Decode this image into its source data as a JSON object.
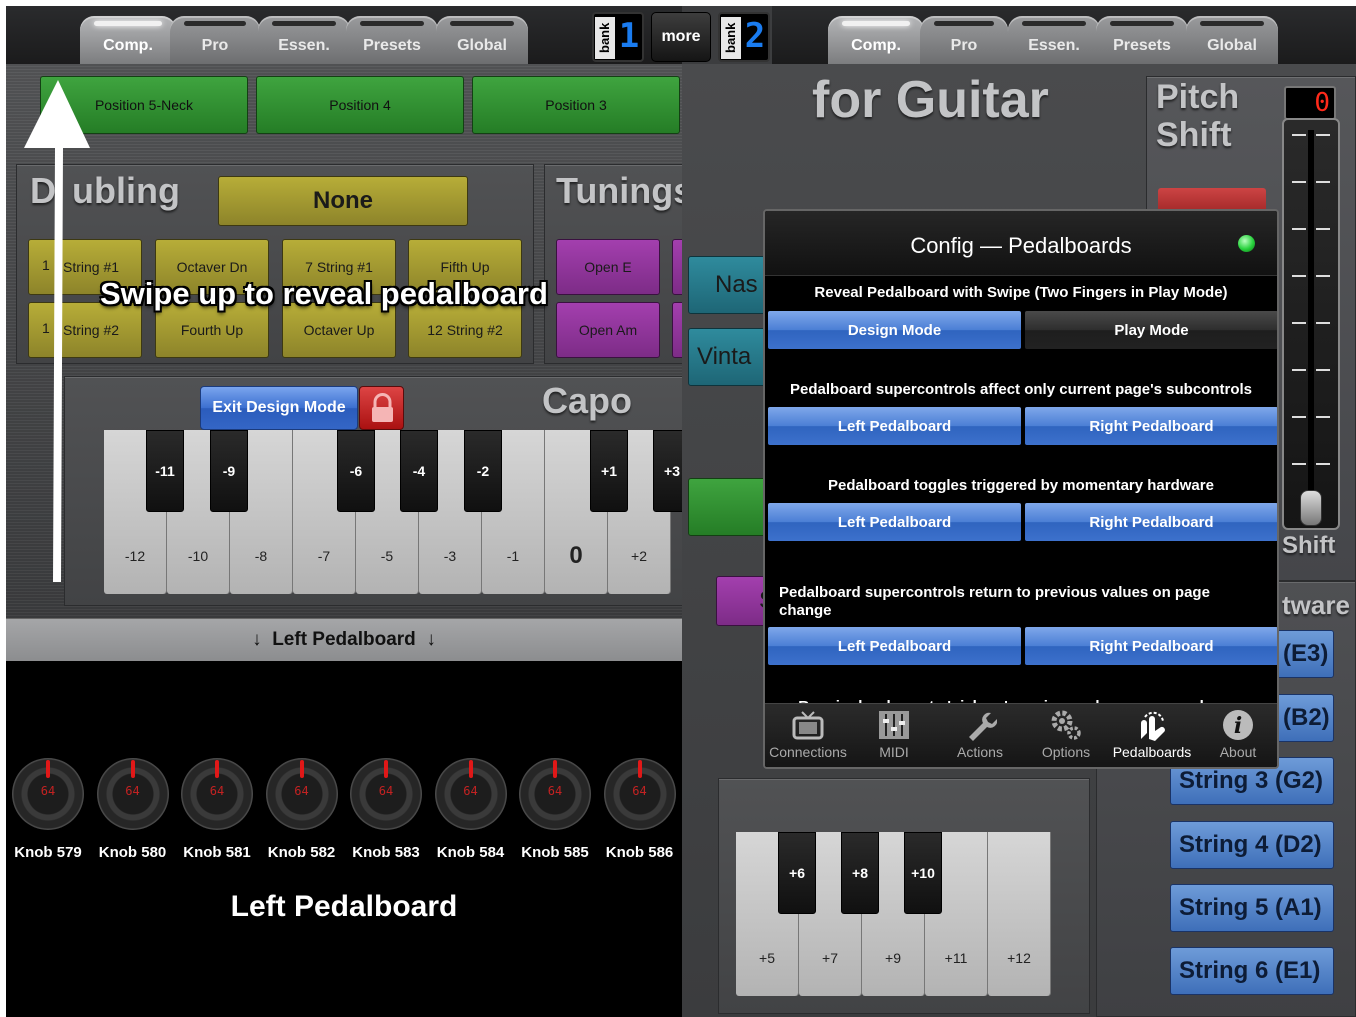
{
  "left_panel": {
    "tabs": [
      "Comp.",
      "Pro",
      "Essen.",
      "Presets",
      "Global"
    ],
    "positions": [
      "Position 5-Neck",
      "Position 4",
      "Position 3"
    ],
    "doubling": {
      "title": "Doubling",
      "title_visible": "D",
      "title_visible_2": "ubling",
      "selected": "None",
      "buttons": [
        "12 String #1",
        "Octaver Dn",
        "7 String #1",
        "Fifth Up",
        "12 String #2",
        "Fourth Up",
        "Octaver Up",
        "12 String #2"
      ],
      "buttons_visible": [
        "1",
        "String #1",
        "Octaver Dn",
        "7 String #1",
        "Fifth Up",
        "1",
        "String #2",
        "Fourth Up",
        "Octaver Up",
        "12 String #2"
      ]
    },
    "tunings": {
      "title": "Tunings",
      "buttons": [
        "Open E",
        "Open Am"
      ]
    },
    "capo": {
      "title": "Capo",
      "exit_design_mode": "Exit Design Mode",
      "white_keys": [
        "-12",
        "-10",
        "-8",
        "-7",
        "-5",
        "-3",
        "-1",
        "0",
        "+2"
      ],
      "black_keys": [
        "-11",
        "-9",
        "-6",
        "-4",
        "-2",
        "+1",
        "+3"
      ]
    },
    "swipe_hint": "Swipe up to reveal pedalboard",
    "pedal_header": "↓  Left Pedalboard  ↓",
    "knobs": [
      {
        "label": "Knob 579",
        "value": "64"
      },
      {
        "label": "Knob 580",
        "value": "64"
      },
      {
        "label": "Knob 581",
        "value": "64"
      },
      {
        "label": "Knob 582",
        "value": "64"
      },
      {
        "label": "Knob 583",
        "value": "64"
      },
      {
        "label": "Knob 584",
        "value": "64"
      },
      {
        "label": "Knob 585",
        "value": "64"
      },
      {
        "label": "Knob 586",
        "value": "64"
      }
    ],
    "pedalboard_title": "Left Pedalboard"
  },
  "center": {
    "bank1_label": "bank",
    "bank1_value": "1",
    "more": "more",
    "bank2_label": "bank",
    "bank2_value": "2"
  },
  "right_panel": {
    "tabs": [
      "Comp.",
      "Pro",
      "Essen.",
      "Presets",
      "Global"
    ],
    "title": "for Guitar",
    "pitch_shift": {
      "line1": "Pitch",
      "line2": "Shift",
      "value": "0",
      "label": "Shift"
    },
    "side_fragments": [
      "Nas",
      "Vinta",
      "S"
    ],
    "hardware_title": "tware",
    "strings": [
      "(E3)",
      "(B2)",
      "String 3 (G2)",
      "String 4 (D2)",
      "String 5 (A1)",
      "String 6 (E1)"
    ],
    "keys_white": [
      "+5",
      "+7",
      "+9",
      "+11",
      "+12"
    ],
    "keys_black": [
      "+6",
      "+8",
      "+10"
    ],
    "config": {
      "title": "Config — Pedalboards",
      "sections": [
        {
          "question": "Reveal Pedalboard with Swipe (Two Fingers in Play Mode)",
          "options": [
            "Design Mode",
            "Play Mode"
          ],
          "active": [
            true,
            false
          ]
        },
        {
          "question": "Pedalboard supercontrols affect only current page's subcontrols",
          "options": [
            "Left Pedalboard",
            "Right Pedalboard"
          ],
          "active": [
            true,
            true
          ]
        },
        {
          "question": "Pedalboard toggles triggered by momentary hardware",
          "options": [
            "Left Pedalboard",
            "Right Pedalboard"
          ],
          "active": [
            true,
            true
          ]
        },
        {
          "question": "Pedalboard supercontrols return to previous values on page change",
          "options": [
            "Left Pedalboard",
            "Right Pedalboard"
          ],
          "active": [
            true,
            true
          ]
        },
        {
          "question": "Require hardware to 'pick-up' previous values on page change"
        }
      ],
      "footer": [
        "Connections",
        "MIDI",
        "Actions",
        "Options",
        "Pedalboards",
        "About"
      ],
      "status_color": "#27d23c"
    }
  }
}
